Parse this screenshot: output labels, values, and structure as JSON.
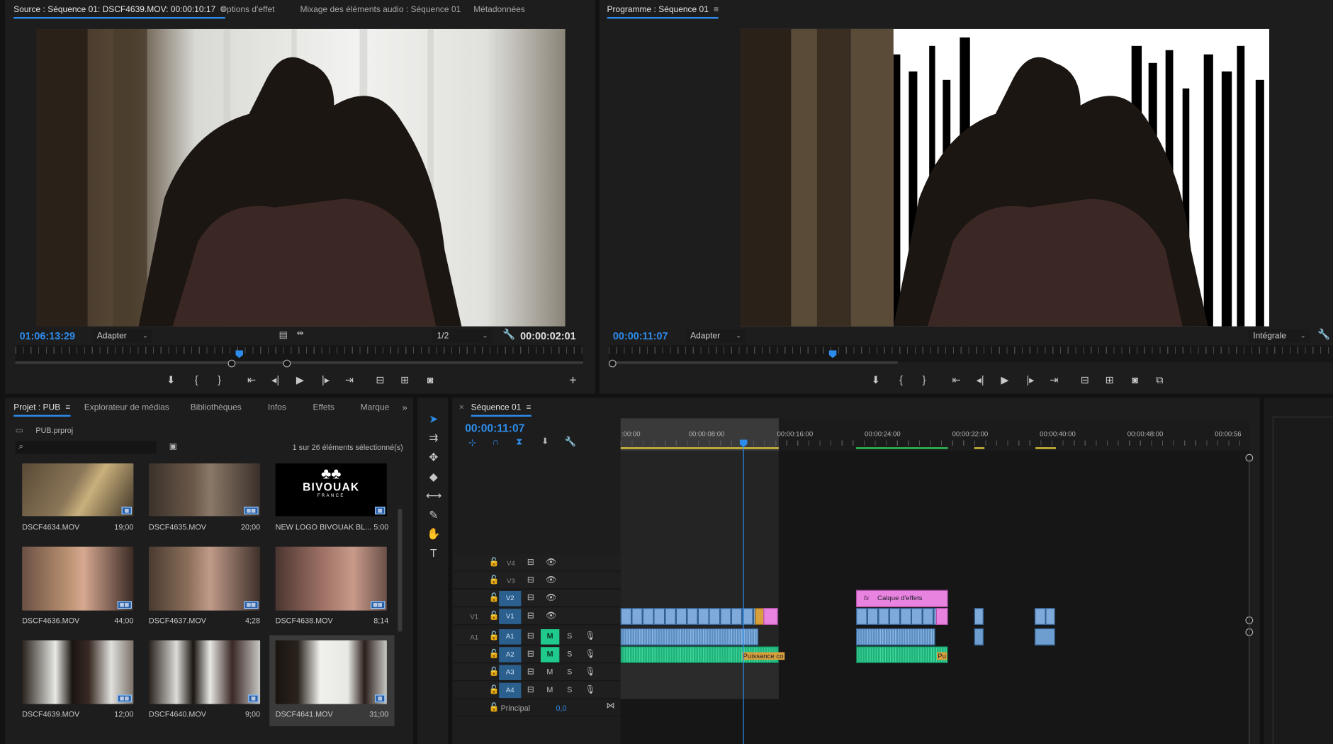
{
  "source_panel": {
    "tabs": [
      "Source : Séquence 01: DSCF4639.MOV: 00:00:10:17",
      "Options d'effet",
      "Mixage des éléments audio : Séquence 01",
      "Métadonnées"
    ],
    "timecode_left": "01:06:13:29",
    "fit": "Adapter",
    "resolution": "1/2",
    "duration": "00:00:02:01",
    "playhead_fraction": 0.4,
    "add_label": "+"
  },
  "program_panel": {
    "tab": "Programme : Séquence 01",
    "timecode": "00:00:11:07",
    "fit": "Adapter",
    "quality": "Intégrale",
    "playhead_fraction": 0.31
  },
  "project_panel": {
    "tabs": [
      "Projet : PUB",
      "Explorateur de médias",
      "Bibliothèques",
      "Infos",
      "Effets",
      "Marque"
    ],
    "project_file": "PUB.prproj",
    "selection_count": "1 sur 26 éléments sélectionné(s)",
    "search_placeholder": "",
    "items": [
      {
        "name": "DSCF4634.MOV",
        "duration": "19;00"
      },
      {
        "name": "DSCF4635.MOV",
        "duration": "20;00"
      },
      {
        "name": "NEW LOGO BIVOUAK BL...",
        "duration": "5:00"
      },
      {
        "name": "DSCF4636.MOV",
        "duration": "44;00"
      },
      {
        "name": "DSCF4637.MOV",
        "duration": "4;28"
      },
      {
        "name": "DSCF4638.MOV",
        "duration": "8;14"
      },
      {
        "name": "DSCF4639.MOV",
        "duration": "12;00"
      },
      {
        "name": "DSCF4640.MOV",
        "duration": "9;00"
      },
      {
        "name": "DSCF4641.MOV",
        "duration": "31;00"
      }
    ],
    "logo_text": "BIVOUAK",
    "logo_sub": "FRANCE"
  },
  "timeline": {
    "tab": "Séquence 01",
    "close": "×",
    "timecode": "00:00:11:07",
    "ruler_labels": [
      ":00:00",
      "00:00:08:00",
      "00:00:16:00",
      "00:00:24:00",
      "00:00:32:00",
      "00:00:40:00",
      "00:00:48:00",
      "00:00:56"
    ],
    "video_tracks": [
      {
        "src": "",
        "name": "V4"
      },
      {
        "src": "",
        "name": "V3"
      },
      {
        "src": "",
        "name": "V2"
      },
      {
        "src": "V1",
        "name": "V1"
      }
    ],
    "audio_tracks": [
      {
        "src": "A1",
        "name": "A1",
        "m": "M",
        "s": "S",
        "m_active": true
      },
      {
        "src": "",
        "name": "A2",
        "m": "M",
        "s": "S",
        "m_active": true
      },
      {
        "src": "",
        "name": "A3",
        "m": "M",
        "s": "S",
        "m_active": false
      },
      {
        "src": "",
        "name": "A4",
        "m": "M",
        "s": "S",
        "m_active": false
      }
    ],
    "master": {
      "label": "Principal",
      "value": "0,0"
    },
    "clips": {
      "effects_layer": "Calque d'effets",
      "audio_a": "Puissance co",
      "audio_b": "Pu",
      "fx": "fx"
    }
  },
  "colors": {
    "accent": "#2d8ceb",
    "clip_video": "#6e9ed0",
    "clip_audio": "#1fb37b",
    "clip_adjustment": "#e884e0",
    "mute_active": "#20c98c"
  }
}
